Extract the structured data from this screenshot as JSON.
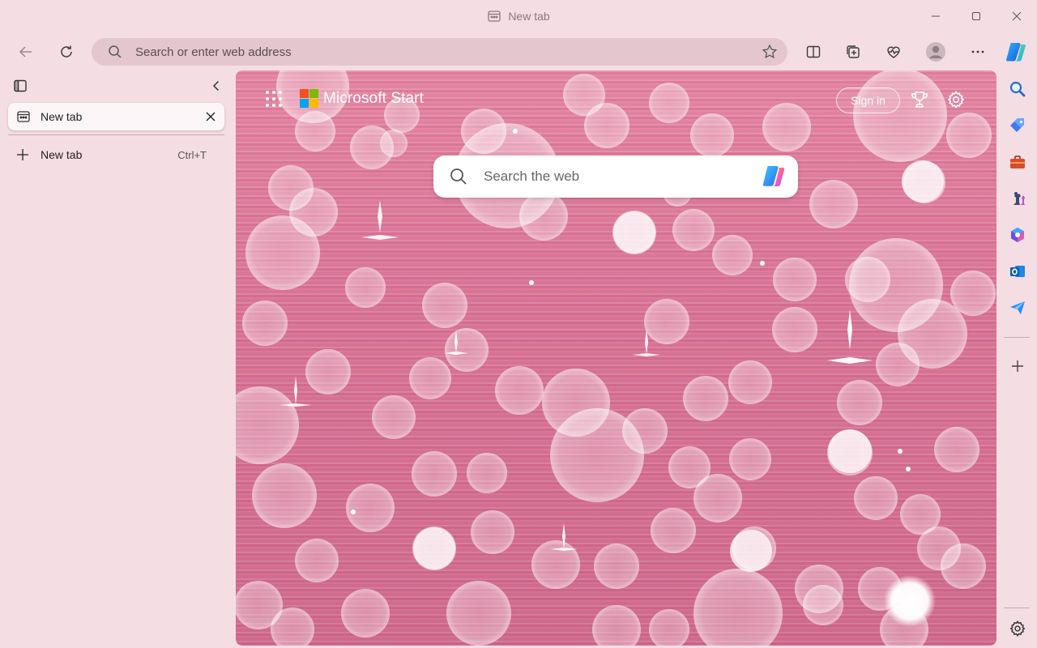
{
  "window": {
    "title": "New tab"
  },
  "toolbar": {
    "address_placeholder": "Search or enter web address"
  },
  "tabs_panel": {
    "tabs": [
      {
        "label": "New tab"
      }
    ],
    "new_tab_label": "New tab",
    "new_tab_shortcut": "Ctrl+T"
  },
  "start_page": {
    "brand": "Microsoft Start",
    "sign_in_label": "Sign in",
    "search_placeholder": "Search the web"
  },
  "colors": {
    "window_background": "#f5dde4",
    "address_bar": "#e4c6cf",
    "content_pink": "#d9779a"
  },
  "sidebar": {
    "items": [
      "search-icon",
      "shopping-tag-icon",
      "tools-icon",
      "games-icon",
      "microsoft365-icon",
      "outlook-icon",
      "send-icon",
      "add-icon",
      "settings-icon"
    ]
  }
}
